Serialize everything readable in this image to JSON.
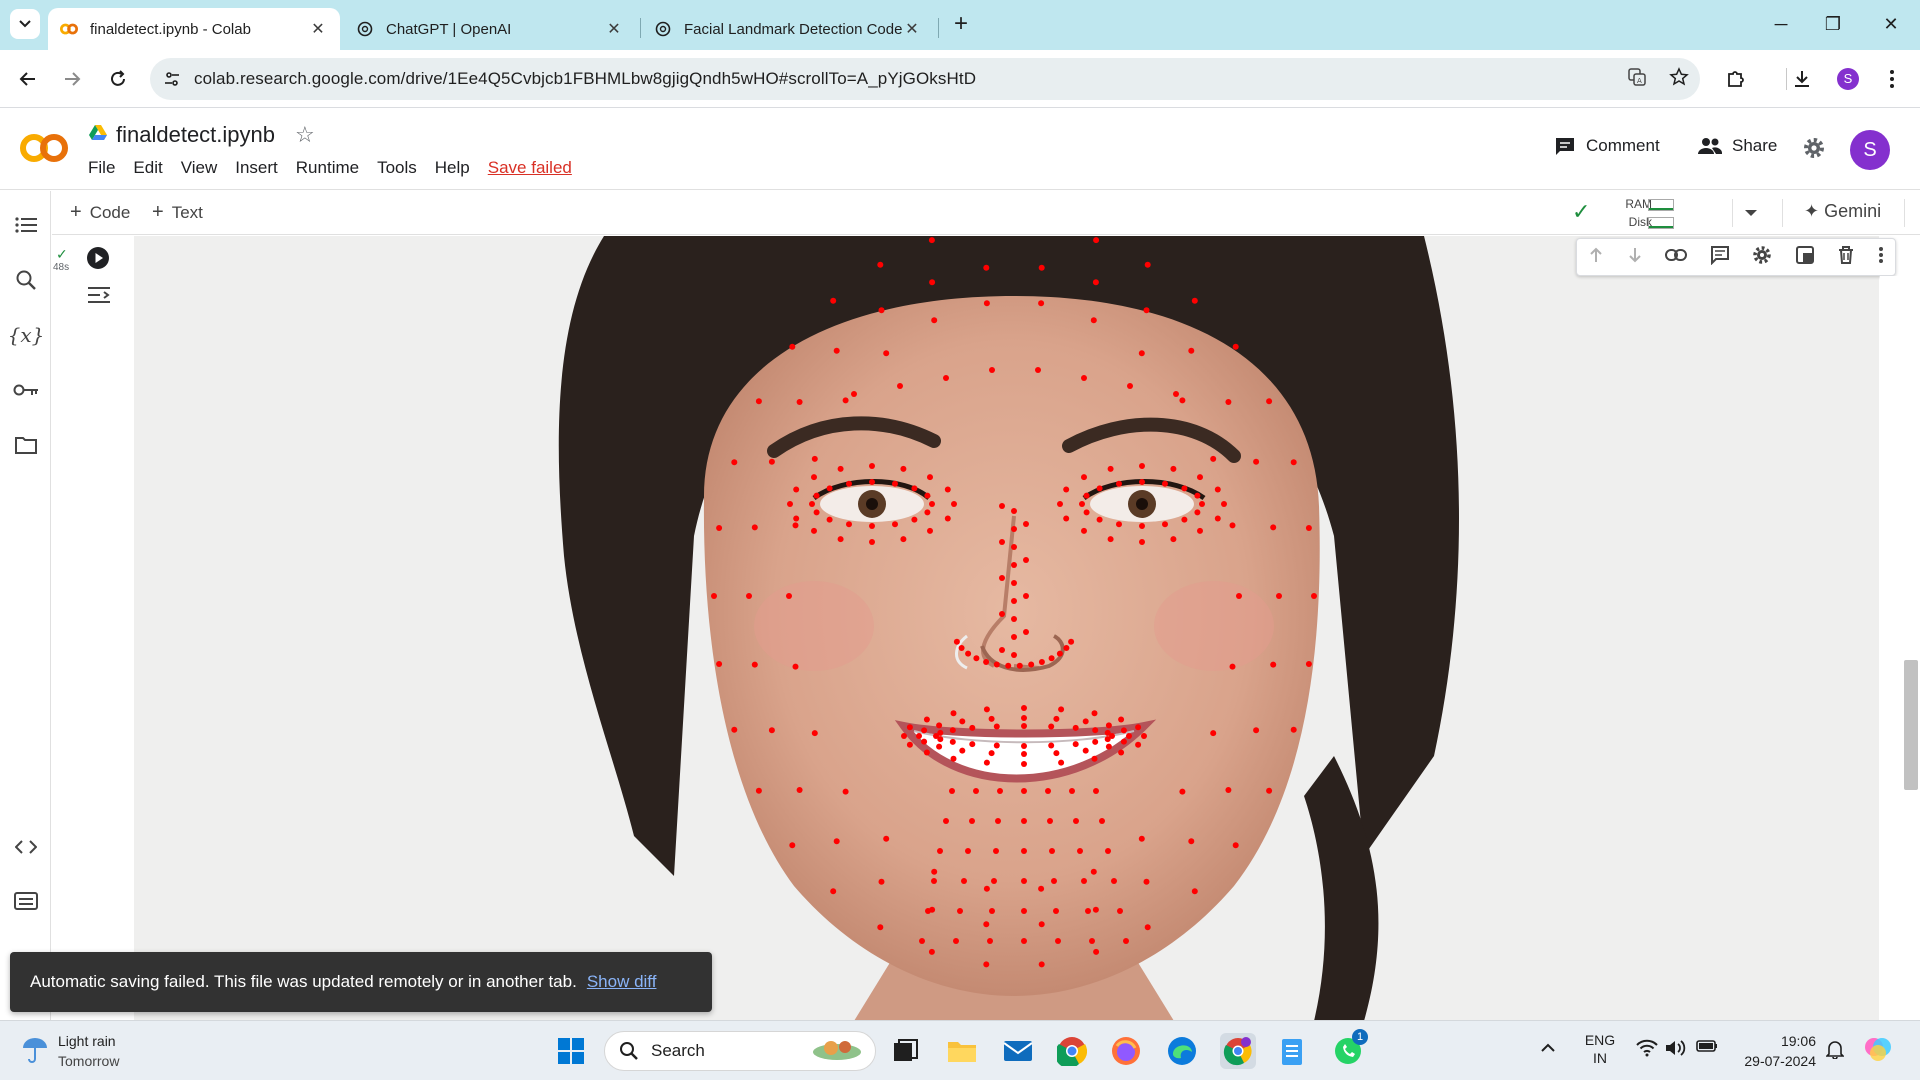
{
  "browser": {
    "tabs": [
      {
        "title": "finaldetect.ipynb - Colab",
        "active": true,
        "icon": "colab-icon"
      },
      {
        "title": "ChatGPT | OpenAI",
        "active": false,
        "icon": "openai-icon"
      },
      {
        "title": "Facial Landmark Detection Code",
        "active": false,
        "icon": "openai-icon"
      }
    ],
    "new_tab": "+",
    "url": "colab.research.google.com/drive/1Ee4Q5Cvbjcb1FBHMLbw8gjigQndh5wHO#scrollTo=A_pYjGOksHtD",
    "profile_initial": "S"
  },
  "colab": {
    "notebook_title": "finaldetect.ipynb",
    "menu": [
      "File",
      "Edit",
      "View",
      "Insert",
      "Runtime",
      "Tools",
      "Help"
    ],
    "save_status": "Save failed",
    "comment_label": "Comment",
    "share_label": "Share",
    "user_initial": "S",
    "toolbar": {
      "add_code": "Code",
      "add_text": "Text",
      "ram_label": "RAM",
      "disk_label": "Disk",
      "gemini_label": "Gemini"
    },
    "cell": {
      "exec_time": "48s",
      "status": "completed"
    }
  },
  "toast": {
    "message": "Automatic saving failed. This file was updated remotely or in another tab.",
    "action": "Show diff"
  },
  "taskbar": {
    "weather_title": "Light rain",
    "weather_sub": "Tomorrow",
    "search_placeholder": "Search",
    "lang_top": "ENG",
    "lang_bottom": "IN",
    "time": "19:06",
    "date": "29-07-2024",
    "whatsapp_badge": "1"
  },
  "colors": {
    "accent": "#f9ab00",
    "save_failed": "#d93025",
    "landmark": "#ff0000"
  }
}
